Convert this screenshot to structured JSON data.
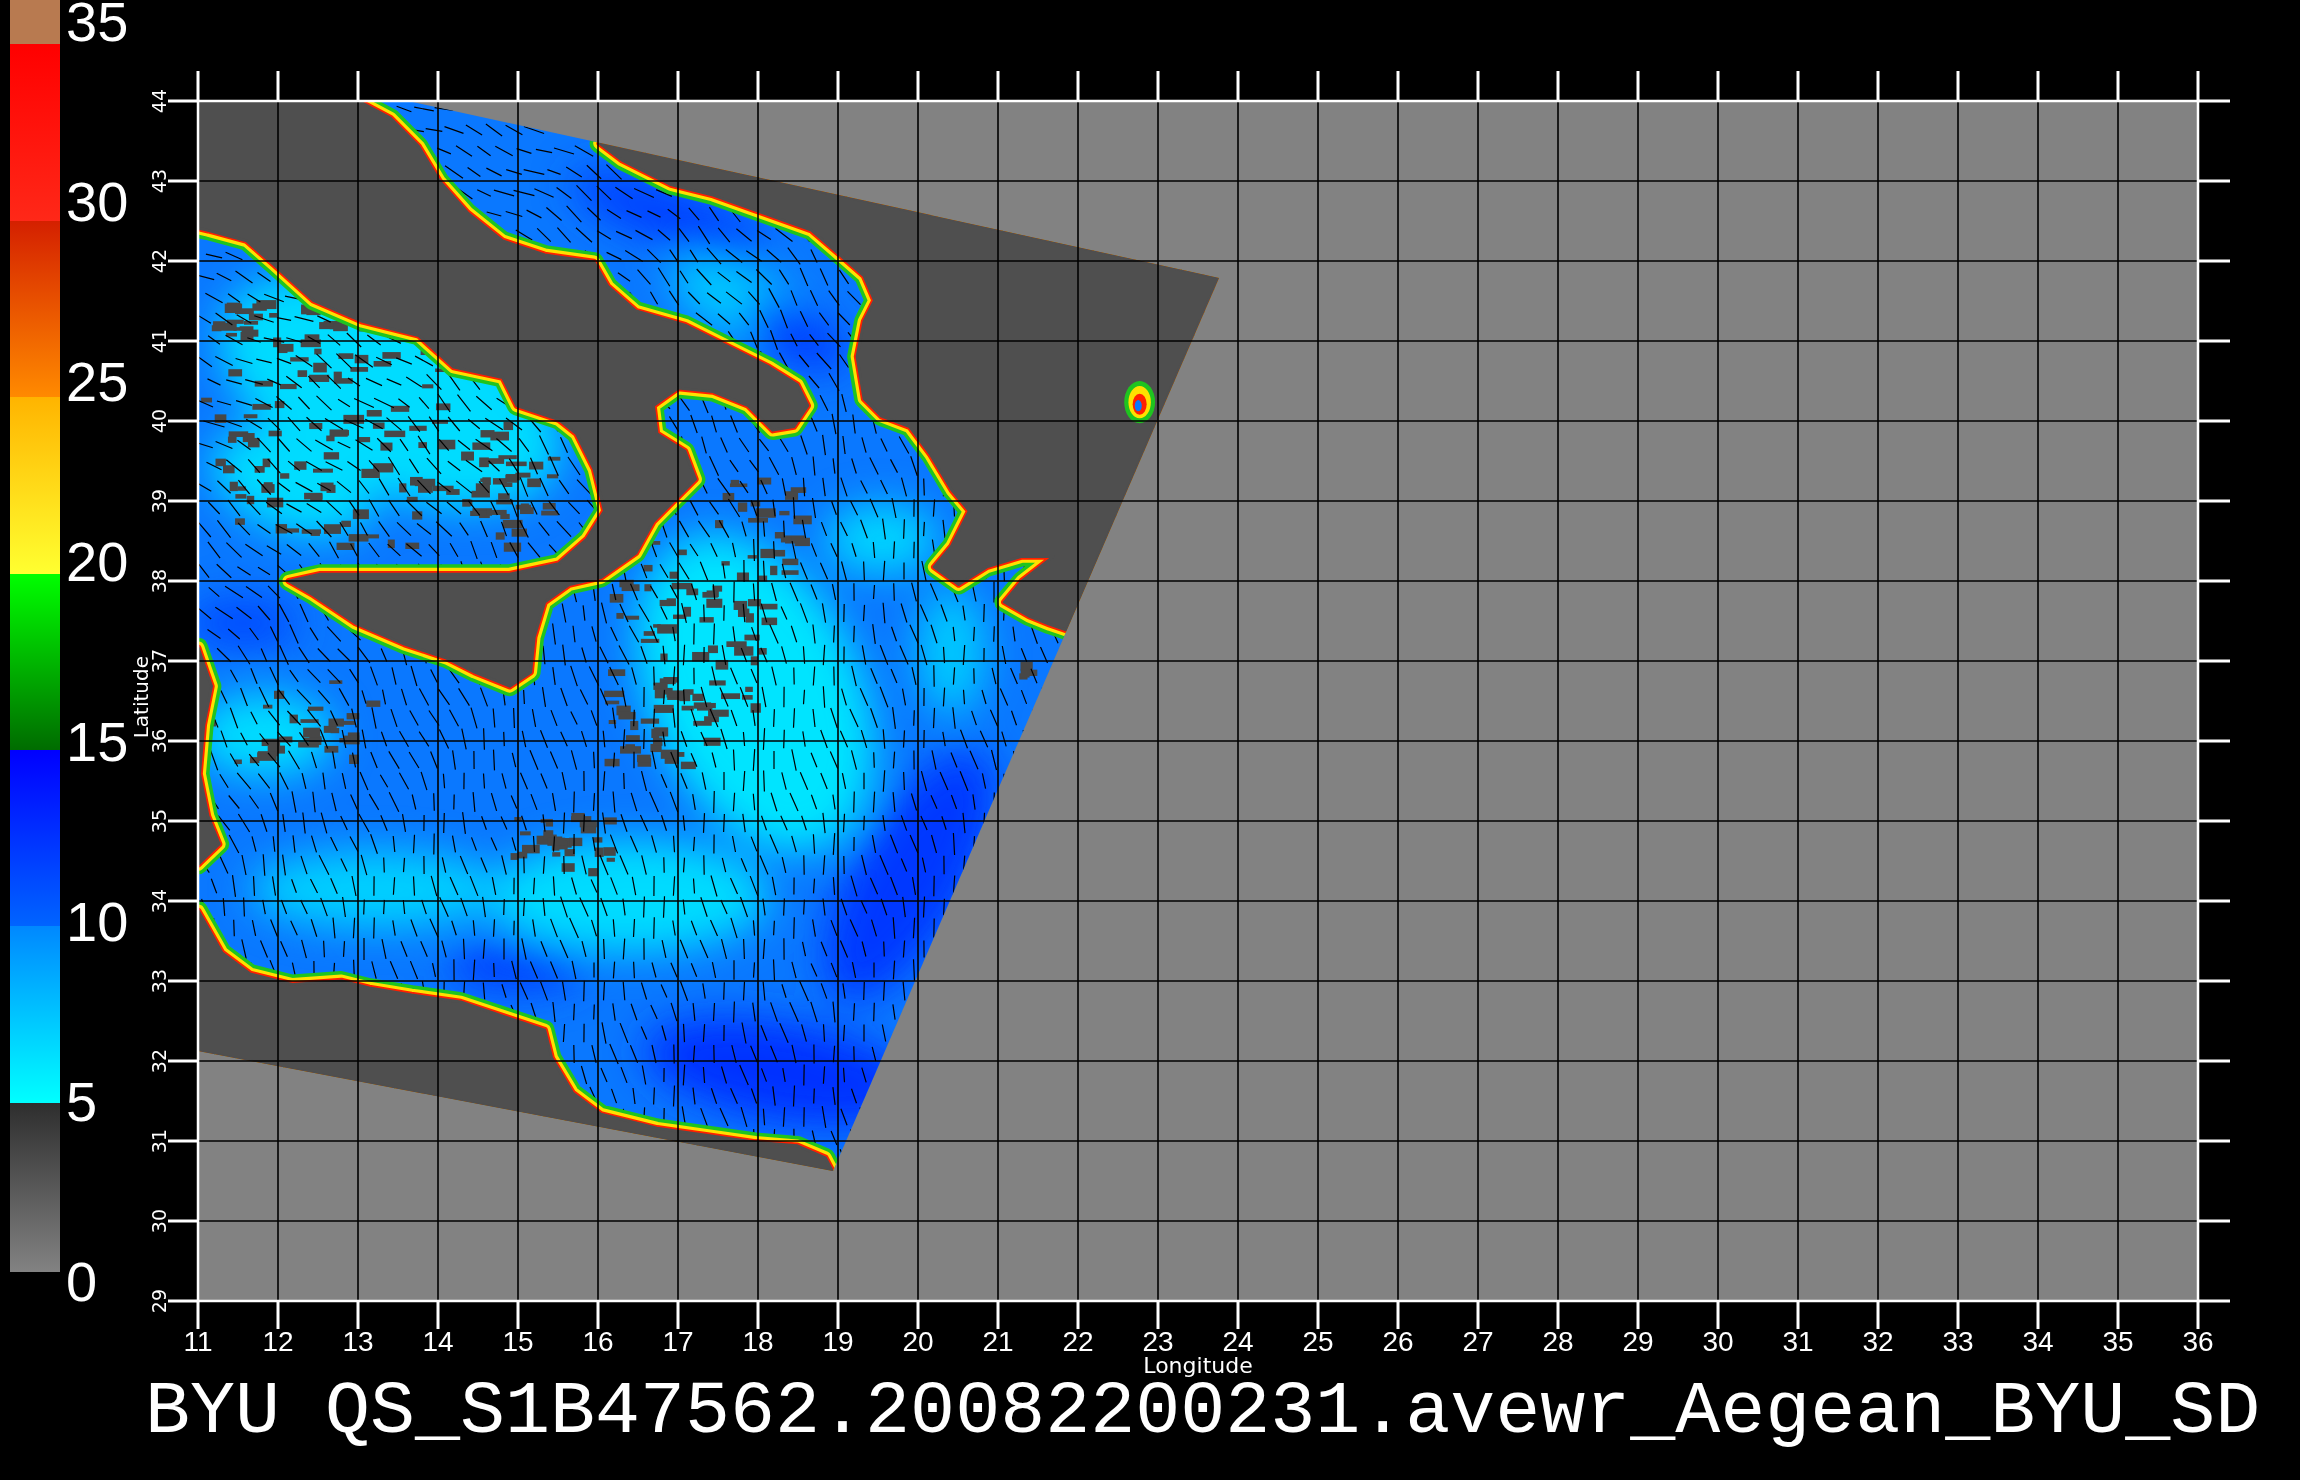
{
  "colorbar": {
    "labels": [
      "35",
      "30",
      "25",
      "20",
      "15",
      "10",
      "5",
      "0"
    ]
  },
  "map": {
    "y_axis": {
      "title": "Latitude",
      "ticks": [
        "44",
        "43",
        "42",
        "41",
        "40",
        "39",
        "38",
        "37",
        "36",
        "35",
        "34",
        "33",
        "32",
        "31",
        "30",
        "29"
      ]
    },
    "x_axis": {
      "ticks": [
        "11",
        "12",
        "13",
        "14",
        "15",
        "16",
        "17",
        "18",
        "19",
        "20",
        "21",
        "22",
        "23",
        "24",
        "25",
        "26",
        "27",
        "28",
        "29",
        "30",
        "31",
        "32",
        "33",
        "34",
        "35",
        "36"
      ],
      "title": "Longitude"
    }
  },
  "title": "BYU QS_S1B47562.20082200231.avewr_Aegean_BYU_SD"
}
